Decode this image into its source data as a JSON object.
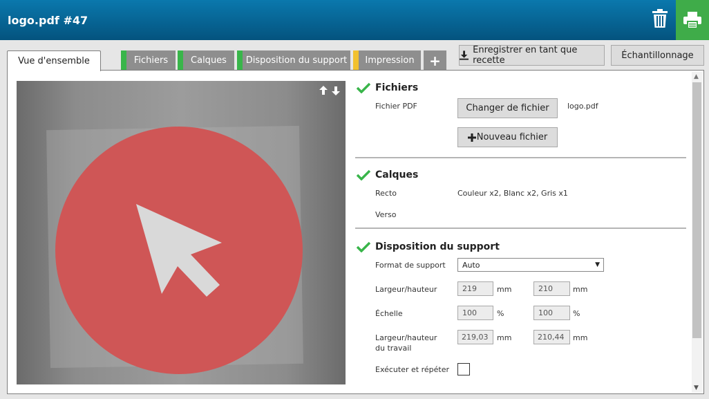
{
  "header": {
    "title": "logo.pdf #47",
    "trash_icon": "trash-icon",
    "print_icon": "printer-icon",
    "print_color": "#3fac49"
  },
  "tabs": [
    {
      "label": "Vue d'ensemble",
      "active": true
    },
    {
      "label": "Fichiers",
      "status_color": "#39b54a"
    },
    {
      "label": "Calques",
      "status_color": "#39b54a"
    },
    {
      "label": "Disposition du support",
      "status_color": "#39b54a"
    },
    {
      "label": "Impression",
      "status_color": "#f2c12e"
    },
    {
      "label": "+"
    }
  ],
  "actions": {
    "save_recipe": "Enregistrer en tant que recette",
    "save_icon": "download-icon",
    "sampling": "Échantillonnage"
  },
  "preview": {
    "sort_icons": "up-down-arrows-icon",
    "circle_color": "#cf5656",
    "pointer_icon": "cursor-arrow-icon"
  },
  "fichiers": {
    "title": "Fichiers",
    "pdf_label": "Fichier PDF",
    "change_button": "Changer de fichier",
    "filename": "logo.pdf",
    "new_button": "Nouveau fichier",
    "new_icon": "plus-icon"
  },
  "calques": {
    "title": "Calques",
    "recto_label": "Recto",
    "recto_value": "Couleur x2, Blanc x2, Gris x1",
    "verso_label": "Verso"
  },
  "disposition": {
    "title": "Disposition du support",
    "format_label": "Format de support",
    "format_value": "Auto",
    "size_label": "Largeur/hauteur",
    "width": "219",
    "height": "210",
    "unit_mm": "mm",
    "scale_label": "Échelle",
    "scale_x": "100",
    "scale_y": "100",
    "unit_pct": "%",
    "job_label_1": "Largeur/hauteur",
    "job_label_2": "du travail",
    "job_width": "219,03",
    "job_height": "210,44",
    "step_repeat_label": "Exécuter et répéter",
    "step_repeat_checked": false
  },
  "check_color": "#39b54a"
}
